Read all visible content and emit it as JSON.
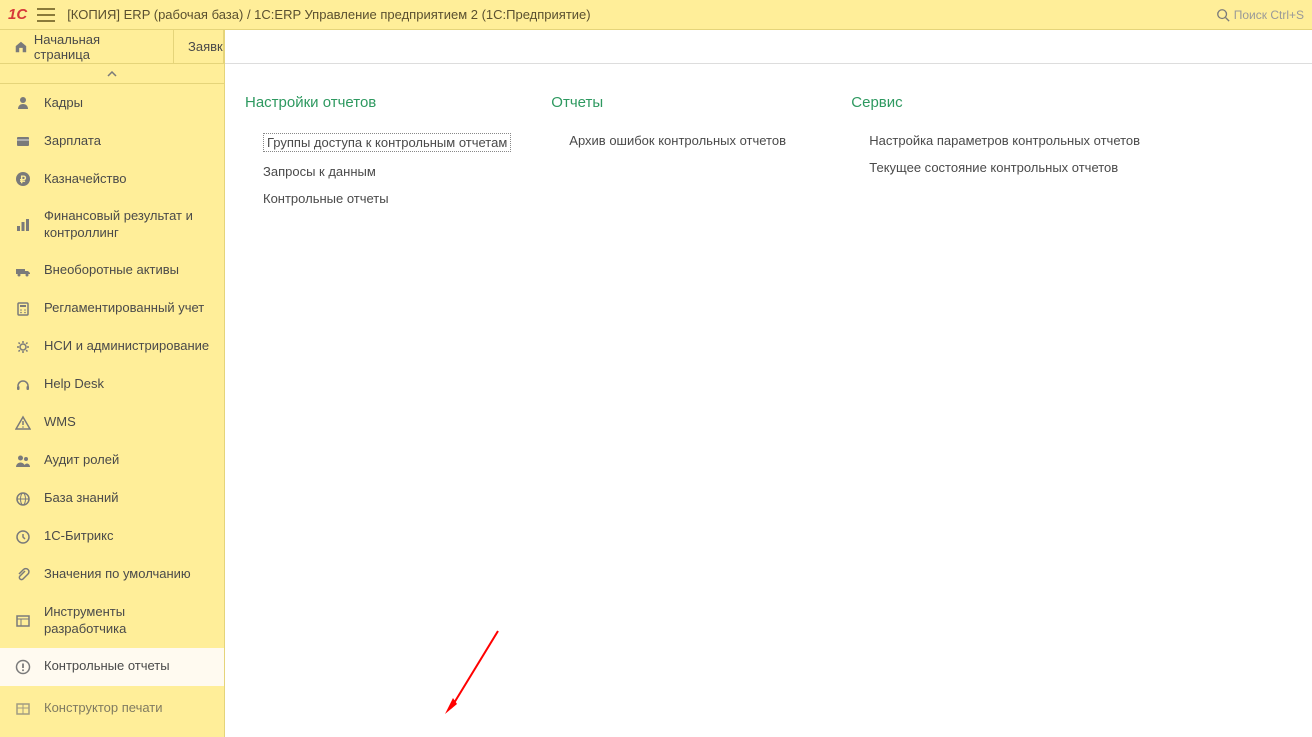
{
  "titlebar": {
    "app_title": "[КОПИЯ] ERP (рабочая база) / 1С:ERP Управление предприятием 2  (1С:Предприятие)",
    "search_placeholder": "Поиск Ctrl+S"
  },
  "tabs": {
    "home": "Начальная страница",
    "second": "Заявки"
  },
  "sidebar": {
    "items": [
      {
        "label": "Кадры",
        "icon": "person-icon"
      },
      {
        "label": "Зарплата",
        "icon": "card-icon"
      },
      {
        "label": "Казначейство",
        "icon": "ruble-icon"
      },
      {
        "label": "Финансовый результат и контроллинг",
        "icon": "bars-icon"
      },
      {
        "label": "Внеоборотные активы",
        "icon": "truck-icon"
      },
      {
        "label": "Регламентированный учет",
        "icon": "calculator-icon"
      },
      {
        "label": "НСИ и администрирование",
        "icon": "gear-icon"
      },
      {
        "label": "Help Desk",
        "icon": "headset-icon"
      },
      {
        "label": "WMS",
        "icon": "warning-icon"
      },
      {
        "label": "Аудит ролей",
        "icon": "people-icon"
      },
      {
        "label": "База знаний",
        "icon": "globe-icon"
      },
      {
        "label": "1С-Битрикс",
        "icon": "clock-icon"
      },
      {
        "label": "Значения по умолчанию",
        "icon": "clip-icon"
      },
      {
        "label": "Инструменты разработчика",
        "icon": "tools-icon"
      },
      {
        "label": "Контрольные отчеты",
        "icon": "exclaim-icon"
      },
      {
        "label": "Конструктор печати",
        "icon": "layout-icon"
      }
    ]
  },
  "main": {
    "sections": [
      {
        "title": "Настройки отчетов",
        "links": [
          "Группы доступа к контрольным отчетам",
          "Запросы к данным",
          "Контрольные отчеты"
        ]
      },
      {
        "title": "Отчеты",
        "links": [
          "Архив ошибок контрольных отчетов"
        ]
      },
      {
        "title": "Сервис",
        "links": [
          "Настройка параметров контрольных отчетов",
          "Текущее состояние контрольных отчетов"
        ]
      }
    ]
  }
}
